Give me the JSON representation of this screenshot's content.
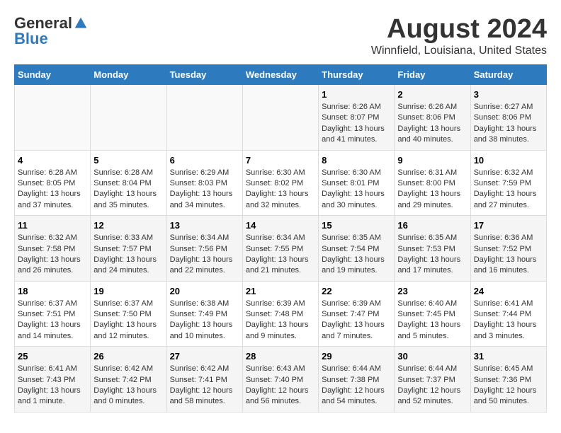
{
  "logo": {
    "general": "General",
    "blue": "Blue"
  },
  "header": {
    "title": "August 2024",
    "subtitle": "Winnfield, Louisiana, United States"
  },
  "days_of_week": [
    "Sunday",
    "Monday",
    "Tuesday",
    "Wednesday",
    "Thursday",
    "Friday",
    "Saturday"
  ],
  "weeks": [
    [
      {
        "day": "",
        "info": ""
      },
      {
        "day": "",
        "info": ""
      },
      {
        "day": "",
        "info": ""
      },
      {
        "day": "",
        "info": ""
      },
      {
        "day": "1",
        "info": "Sunrise: 6:26 AM\nSunset: 8:07 PM\nDaylight: 13 hours\nand 41 minutes."
      },
      {
        "day": "2",
        "info": "Sunrise: 6:26 AM\nSunset: 8:06 PM\nDaylight: 13 hours\nand 40 minutes."
      },
      {
        "day": "3",
        "info": "Sunrise: 6:27 AM\nSunset: 8:06 PM\nDaylight: 13 hours\nand 38 minutes."
      }
    ],
    [
      {
        "day": "4",
        "info": "Sunrise: 6:28 AM\nSunset: 8:05 PM\nDaylight: 13 hours\nand 37 minutes."
      },
      {
        "day": "5",
        "info": "Sunrise: 6:28 AM\nSunset: 8:04 PM\nDaylight: 13 hours\nand 35 minutes."
      },
      {
        "day": "6",
        "info": "Sunrise: 6:29 AM\nSunset: 8:03 PM\nDaylight: 13 hours\nand 34 minutes."
      },
      {
        "day": "7",
        "info": "Sunrise: 6:30 AM\nSunset: 8:02 PM\nDaylight: 13 hours\nand 32 minutes."
      },
      {
        "day": "8",
        "info": "Sunrise: 6:30 AM\nSunset: 8:01 PM\nDaylight: 13 hours\nand 30 minutes."
      },
      {
        "day": "9",
        "info": "Sunrise: 6:31 AM\nSunset: 8:00 PM\nDaylight: 13 hours\nand 29 minutes."
      },
      {
        "day": "10",
        "info": "Sunrise: 6:32 AM\nSunset: 7:59 PM\nDaylight: 13 hours\nand 27 minutes."
      }
    ],
    [
      {
        "day": "11",
        "info": "Sunrise: 6:32 AM\nSunset: 7:58 PM\nDaylight: 13 hours\nand 26 minutes."
      },
      {
        "day": "12",
        "info": "Sunrise: 6:33 AM\nSunset: 7:57 PM\nDaylight: 13 hours\nand 24 minutes."
      },
      {
        "day": "13",
        "info": "Sunrise: 6:34 AM\nSunset: 7:56 PM\nDaylight: 13 hours\nand 22 minutes."
      },
      {
        "day": "14",
        "info": "Sunrise: 6:34 AM\nSunset: 7:55 PM\nDaylight: 13 hours\nand 21 minutes."
      },
      {
        "day": "15",
        "info": "Sunrise: 6:35 AM\nSunset: 7:54 PM\nDaylight: 13 hours\nand 19 minutes."
      },
      {
        "day": "16",
        "info": "Sunrise: 6:35 AM\nSunset: 7:53 PM\nDaylight: 13 hours\nand 17 minutes."
      },
      {
        "day": "17",
        "info": "Sunrise: 6:36 AM\nSunset: 7:52 PM\nDaylight: 13 hours\nand 16 minutes."
      }
    ],
    [
      {
        "day": "18",
        "info": "Sunrise: 6:37 AM\nSunset: 7:51 PM\nDaylight: 13 hours\nand 14 minutes."
      },
      {
        "day": "19",
        "info": "Sunrise: 6:37 AM\nSunset: 7:50 PM\nDaylight: 13 hours\nand 12 minutes."
      },
      {
        "day": "20",
        "info": "Sunrise: 6:38 AM\nSunset: 7:49 PM\nDaylight: 13 hours\nand 10 minutes."
      },
      {
        "day": "21",
        "info": "Sunrise: 6:39 AM\nSunset: 7:48 PM\nDaylight: 13 hours\nand 9 minutes."
      },
      {
        "day": "22",
        "info": "Sunrise: 6:39 AM\nSunset: 7:47 PM\nDaylight: 13 hours\nand 7 minutes."
      },
      {
        "day": "23",
        "info": "Sunrise: 6:40 AM\nSunset: 7:45 PM\nDaylight: 13 hours\nand 5 minutes."
      },
      {
        "day": "24",
        "info": "Sunrise: 6:41 AM\nSunset: 7:44 PM\nDaylight: 13 hours\nand 3 minutes."
      }
    ],
    [
      {
        "day": "25",
        "info": "Sunrise: 6:41 AM\nSunset: 7:43 PM\nDaylight: 13 hours\nand 1 minute."
      },
      {
        "day": "26",
        "info": "Sunrise: 6:42 AM\nSunset: 7:42 PM\nDaylight: 13 hours\nand 0 minutes."
      },
      {
        "day": "27",
        "info": "Sunrise: 6:42 AM\nSunset: 7:41 PM\nDaylight: 12 hours\nand 58 minutes."
      },
      {
        "day": "28",
        "info": "Sunrise: 6:43 AM\nSunset: 7:40 PM\nDaylight: 12 hours\nand 56 minutes."
      },
      {
        "day": "29",
        "info": "Sunrise: 6:44 AM\nSunset: 7:38 PM\nDaylight: 12 hours\nand 54 minutes."
      },
      {
        "day": "30",
        "info": "Sunrise: 6:44 AM\nSunset: 7:37 PM\nDaylight: 12 hours\nand 52 minutes."
      },
      {
        "day": "31",
        "info": "Sunrise: 6:45 AM\nSunset: 7:36 PM\nDaylight: 12 hours\nand 50 minutes."
      }
    ]
  ]
}
